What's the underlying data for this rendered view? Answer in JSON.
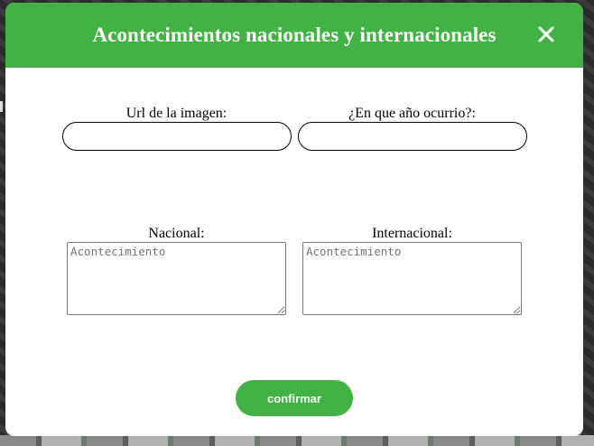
{
  "modal": {
    "title": "Acontecimientos nacionales y internacionales",
    "close_icon": "close-icon",
    "accent_color": "#42b245"
  },
  "form": {
    "url_label": "Url de la imagen:",
    "url_value": "",
    "year_label": "¿En que año ocurrio?:",
    "year_value": "",
    "national_label": "Nacional:",
    "national_placeholder": "Acontecimiento",
    "international_label": "Internacional:",
    "international_placeholder": "Acontecimiento",
    "confirm_label": "confirmar"
  }
}
